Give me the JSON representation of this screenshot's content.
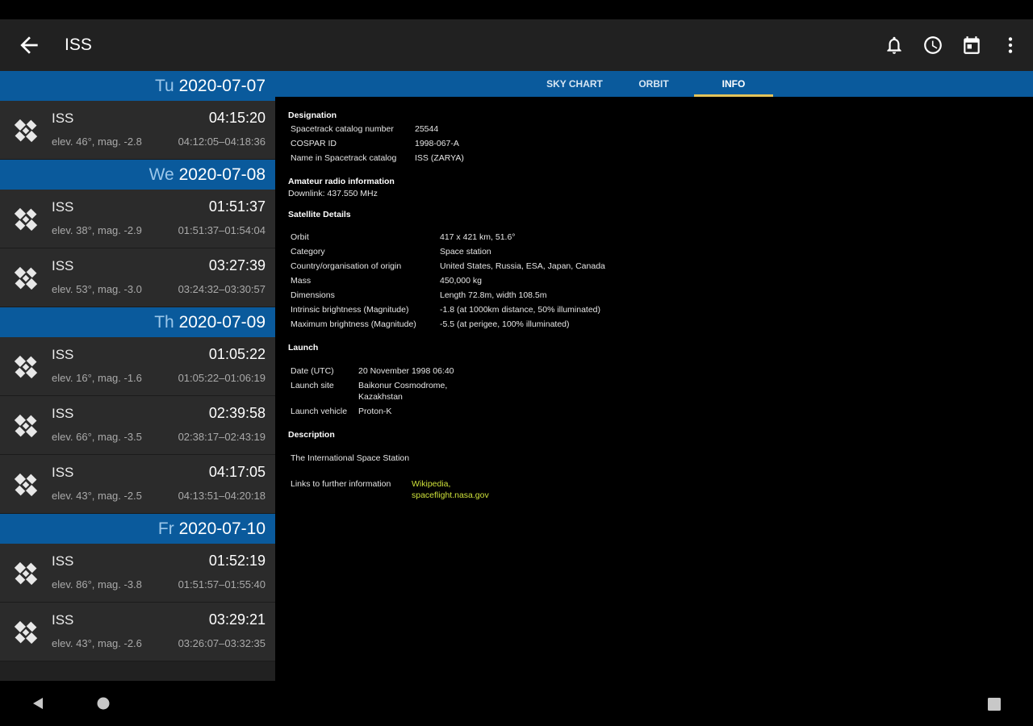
{
  "app": {
    "title": "ISS",
    "icons": {
      "back": "arrow-back-icon",
      "alarm": "bell-icon",
      "clock": "clock-icon",
      "calendar": "calendar-icon",
      "menu": "more-vert-icon"
    }
  },
  "colors": {
    "appbar": "#212121",
    "accent_blue": "#0a5a9c",
    "tab_indicator": "#e3c45c",
    "link": "#cde03a"
  },
  "tabs": [
    {
      "label": "SKY CHART",
      "active": false
    },
    {
      "label": "ORBIT",
      "active": false
    },
    {
      "label": "INFO",
      "active": true
    }
  ],
  "days": [
    {
      "weekday": "Tu",
      "date": "2020-07-07",
      "passes": [
        {
          "name": "ISS",
          "time": "04:15:20",
          "elev": "elev. 46°, mag. -2.8",
          "range": "04:12:05–04:18:36"
        }
      ]
    },
    {
      "weekday": "We",
      "date": "2020-07-08",
      "passes": [
        {
          "name": "ISS",
          "time": "01:51:37",
          "elev": "elev. 38°, mag. -2.9",
          "range": "01:51:37–01:54:04"
        },
        {
          "name": "ISS",
          "time": "03:27:39",
          "elev": "elev. 53°, mag. -3.0",
          "range": "03:24:32–03:30:57"
        }
      ]
    },
    {
      "weekday": "Th",
      "date": "2020-07-09",
      "passes": [
        {
          "name": "ISS",
          "time": "01:05:22",
          "elev": "elev. 16°, mag. -1.6",
          "range": "01:05:22–01:06:19"
        },
        {
          "name": "ISS",
          "time": "02:39:58",
          "elev": "elev. 66°, mag. -3.5",
          "range": "02:38:17–02:43:19"
        },
        {
          "name": "ISS",
          "time": "04:17:05",
          "elev": "elev. 43°, mag. -2.5",
          "range": "04:13:51–04:20:18"
        }
      ]
    },
    {
      "weekday": "Fr",
      "date": "2020-07-10",
      "passes": [
        {
          "name": "ISS",
          "time": "01:52:19",
          "elev": "elev. 86°, mag. -3.8",
          "range": "01:51:57–01:55:40"
        },
        {
          "name": "ISS",
          "time": "03:29:21",
          "elev": "elev. 43°, mag. -2.6",
          "range": "03:26:07–03:32:35"
        }
      ]
    }
  ],
  "info": {
    "designation": {
      "heading": "Designation",
      "rows": [
        {
          "label": "Spacetrack catalog number",
          "value": "25544"
        },
        {
          "label": "COSPAR ID",
          "value": "1998-067-A"
        },
        {
          "label": "Name in Spacetrack catalog",
          "value": "ISS (ZARYA)"
        }
      ]
    },
    "radio": {
      "heading": "Amateur radio information",
      "downlink": "Downlink: 437.550 MHz"
    },
    "details": {
      "heading": "Satellite Details",
      "rows": [
        {
          "label": "Orbit",
          "value": "417 x 421 km, 51.6°"
        },
        {
          "label": "Category",
          "value": "Space station"
        },
        {
          "label": "Country/organisation of origin",
          "value": "United States, Russia, ESA, Japan, Canada"
        },
        {
          "label": "Mass",
          "value": "450,000 kg"
        },
        {
          "label": "Dimensions",
          "value": "Length 72.8m, width 108.5m"
        },
        {
          "label": "Intrinsic brightness (Magnitude)",
          "value": "-1.8 (at 1000km distance, 50% illuminated)"
        },
        {
          "label": "Maximum brightness (Magnitude)",
          "value": "-5.5 (at perigee, 100% illuminated)"
        }
      ]
    },
    "launch": {
      "heading": "Launch",
      "rows": [
        {
          "label": "Date (UTC)",
          "value": "20 November 1998 06:40"
        },
        {
          "label": "Launch site",
          "value": "Baikonur Cosmodrome,",
          "value2": "Kazakhstan"
        },
        {
          "label": "Launch vehicle",
          "value": "Proton-K"
        }
      ]
    },
    "description": {
      "heading": "Description",
      "text": "The International Space Station",
      "links_label": "Links to further information",
      "link1": "Wikipedia,",
      "link2": "spaceflight.nasa.gov"
    }
  },
  "navbar": {
    "back": "nav-back-icon",
    "home": "nav-home-icon",
    "recents": "nav-recents-icon"
  }
}
